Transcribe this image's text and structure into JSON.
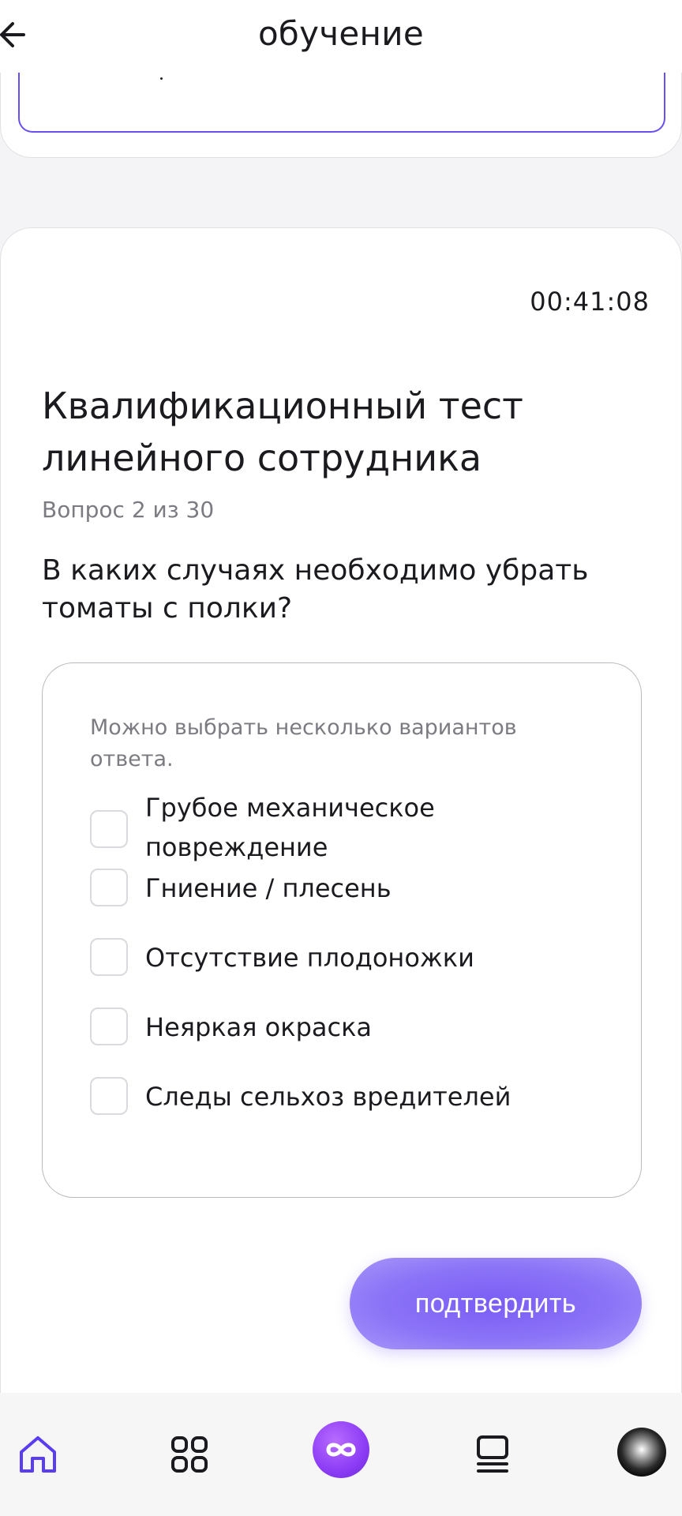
{
  "header": {
    "title": "обучение",
    "back_icon": "arrow-left-icon"
  },
  "quiz": {
    "timer": "00:41:08",
    "title": "Квалификационный тест линейного сотрудника",
    "counter": "Вопрос 2 из 30",
    "question": "В каких случаях необходимо убрать томаты с полки?",
    "hint": "Можно выбрать несколько вариантов ответа.",
    "options": [
      {
        "label": "Грубое механическое повреждение",
        "checked": false
      },
      {
        "label": "Гниение / плесень",
        "checked": false
      },
      {
        "label": "Отсутствие плодоножки",
        "checked": false
      },
      {
        "label": "Неяркая окраска",
        "checked": false
      },
      {
        "label": "Следы сельхоз вредителей",
        "checked": false
      }
    ],
    "confirm_label": "подтвердить"
  },
  "bottom_nav": [
    {
      "icon": "home-icon"
    },
    {
      "icon": "apps-grid-icon"
    },
    {
      "icon": "infinity-logo-icon"
    },
    {
      "icon": "feed-list-icon"
    },
    {
      "icon": "avatar"
    }
  ],
  "colors": {
    "accent": "#7a5cf5",
    "input_border": "#6b4ef0",
    "home_icon": "#5a3df0",
    "muted_text": "#7b7b82"
  }
}
